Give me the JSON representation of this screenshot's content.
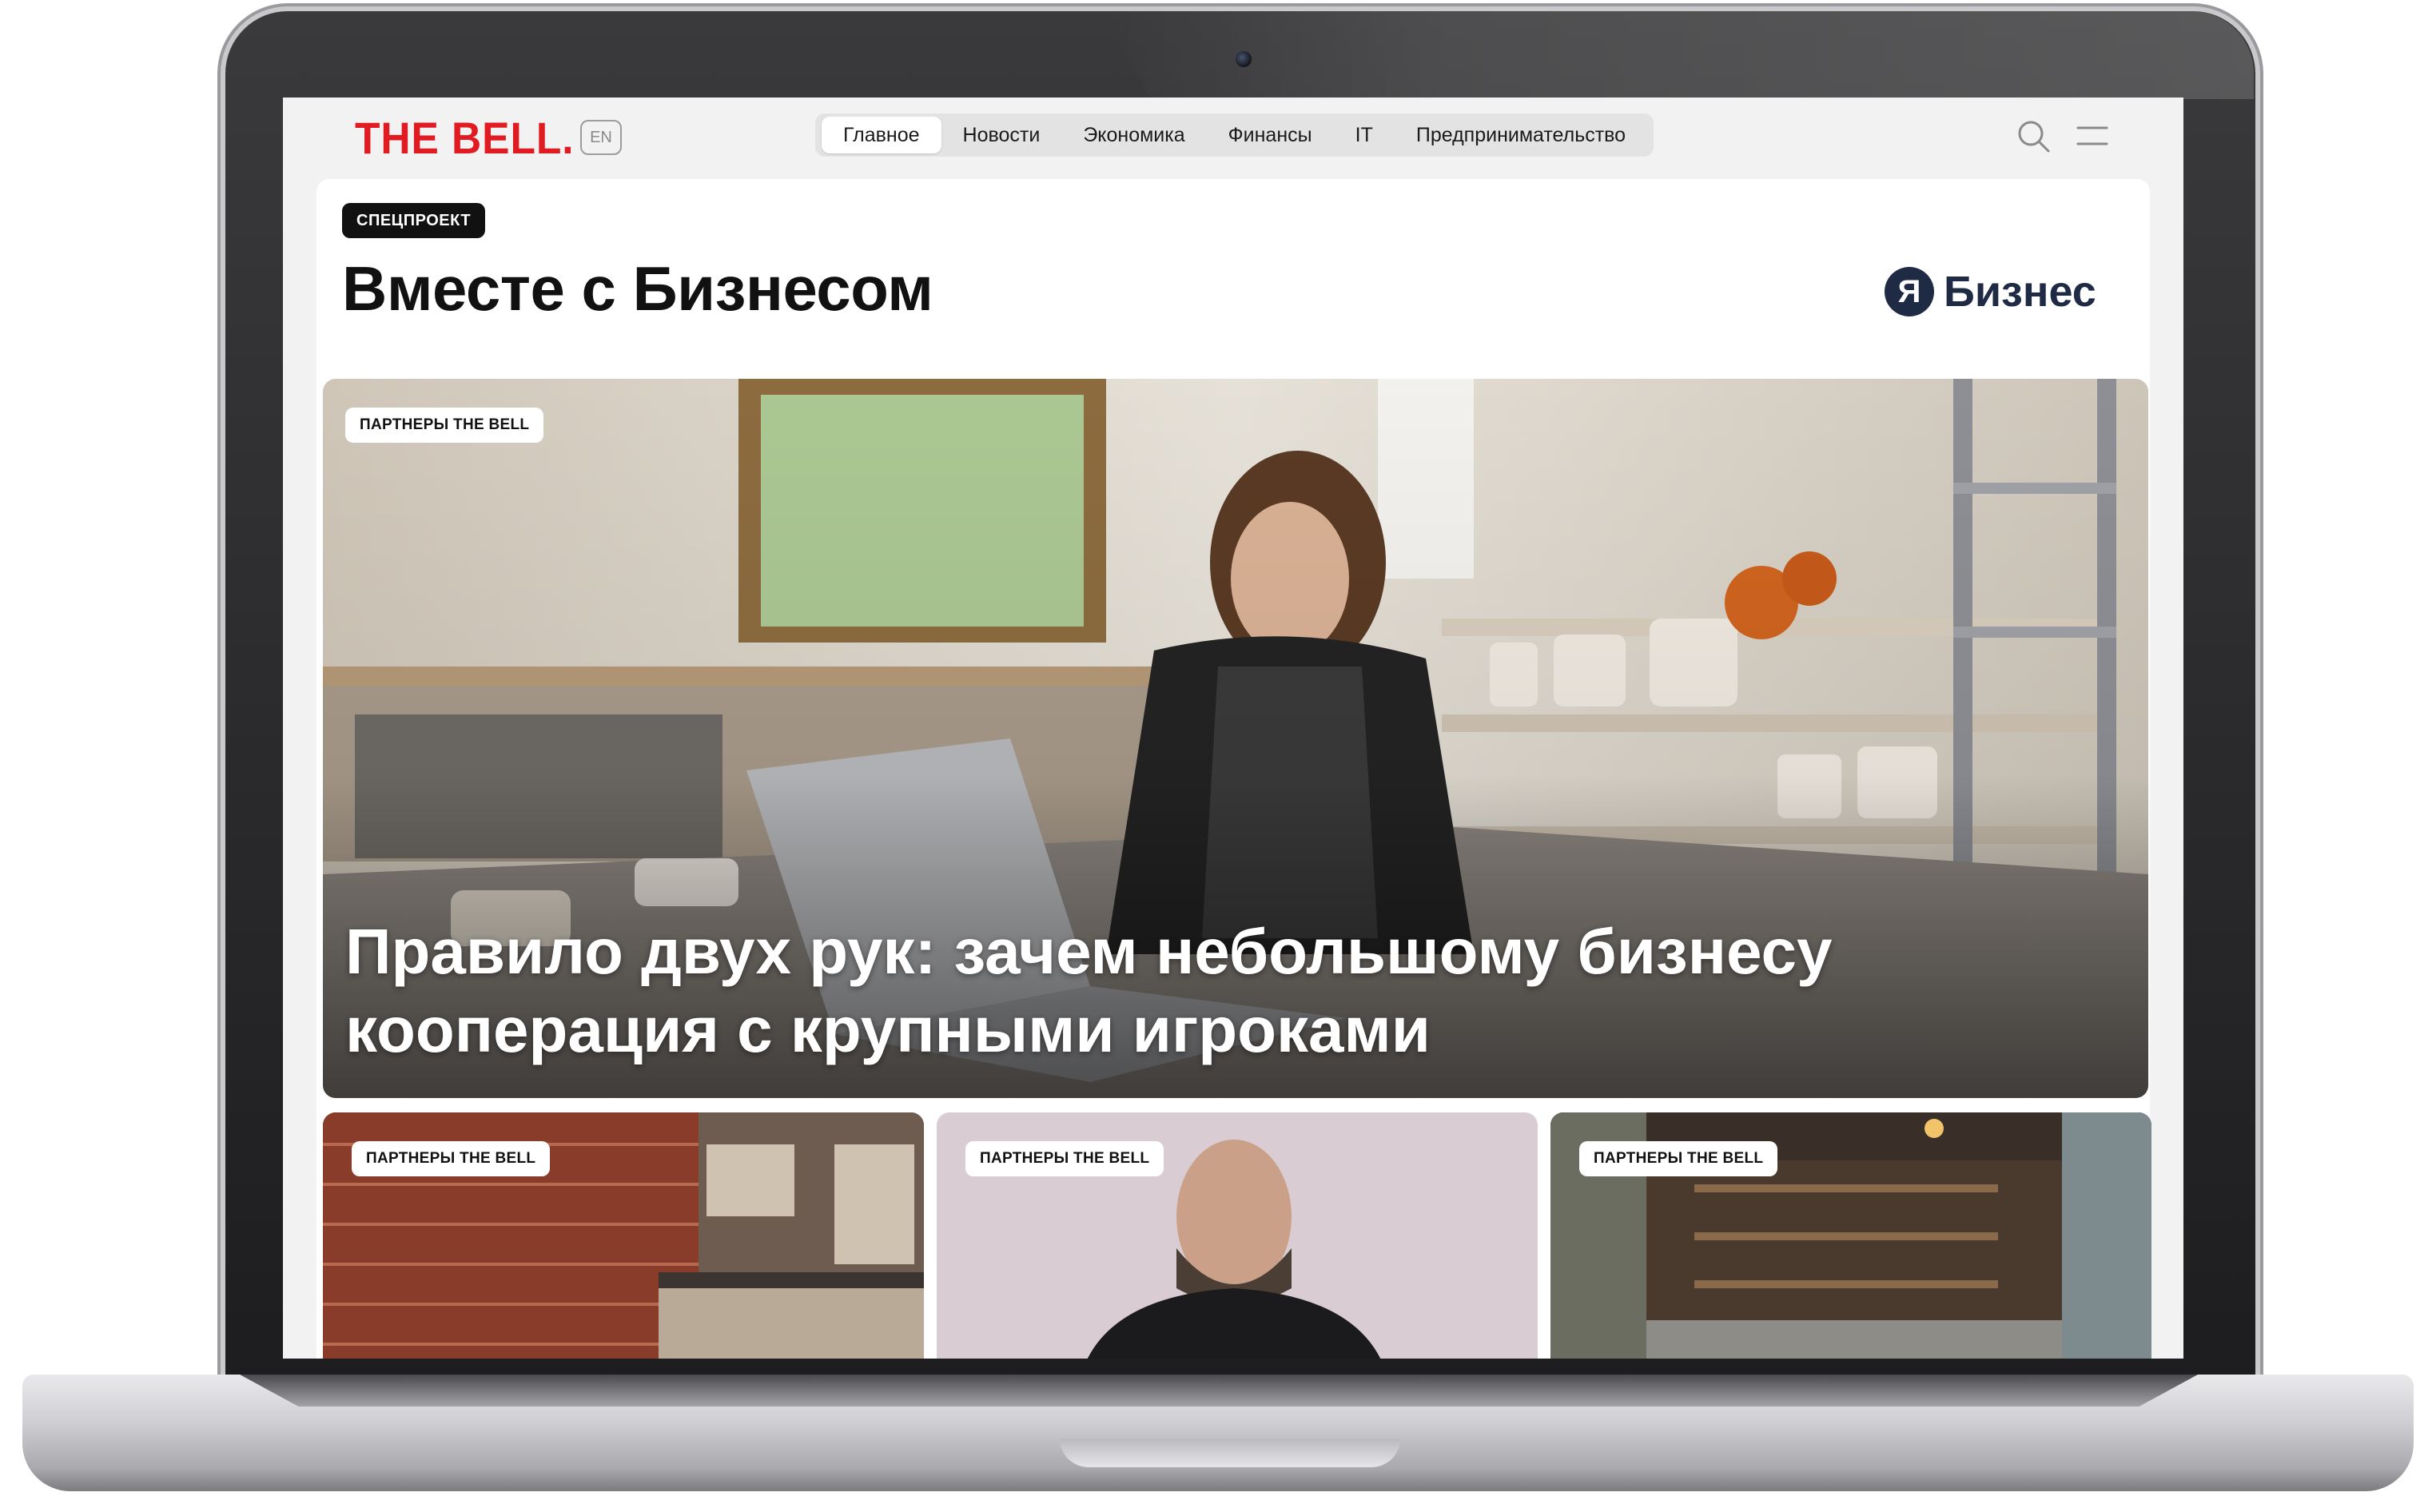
{
  "header": {
    "logo": "THE BELL.",
    "lang": "EN",
    "nav": [
      "Главное",
      "Новости",
      "Экономика",
      "Финансы",
      "IT",
      "Предпринимательство"
    ],
    "active_nav": "Главное"
  },
  "page": {
    "badge": "СПЕЦПРОЕКТ",
    "title": "Вместе с Бизнесом",
    "partner_logo": {
      "glyph": "Я",
      "text": "Бизнес"
    }
  },
  "hero": {
    "badge": "ПАРТНЕРЫ THE BELL",
    "title": "Правило двух рук: зачем небольшому бизнесу кооперация с крупными игроками"
  },
  "cards": [
    {
      "badge": "ПАРТНЕРЫ THE BELL"
    },
    {
      "badge": "ПАРТНЕРЫ THE BELL"
    },
    {
      "badge": "ПАРТНЕРЫ THE BELL"
    }
  ],
  "colors": {
    "logo_red": "#e11b22",
    "partner_navy": "#1f2a44",
    "nav_bg": "#e3e3e3",
    "screen_bg": "#f2f2f2"
  },
  "icons": [
    "search-icon",
    "menu-icon",
    "ya-logo-icon"
  ]
}
